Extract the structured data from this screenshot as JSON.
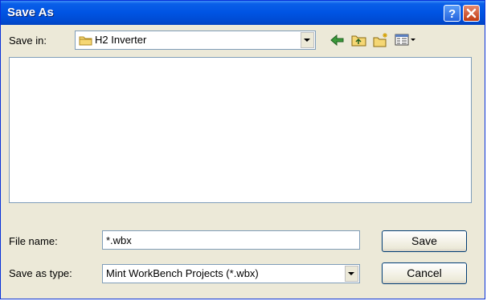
{
  "window": {
    "title": "Save As",
    "help_icon": "help-icon",
    "close_icon": "close-icon"
  },
  "toolbar": {
    "save_in_label": "Save in:",
    "current_folder": "H2 Inverter",
    "folder_icon": "folder-icon",
    "icons": [
      "back-arrow-icon",
      "up-folder-icon",
      "new-folder-icon",
      "views-menu-icon"
    ]
  },
  "form": {
    "file_name_label": "File name:",
    "file_name_value": "*.wbx",
    "save_as_type_label": "Save as type:",
    "save_as_type_value": "Mint WorkBench Projects (*.wbx)"
  },
  "buttons": {
    "save": "Save",
    "cancel": "Cancel"
  },
  "colors": {
    "title_bar": "#0054e3",
    "dialog_bg": "#ece9d8",
    "close_red": "#c23c12"
  }
}
